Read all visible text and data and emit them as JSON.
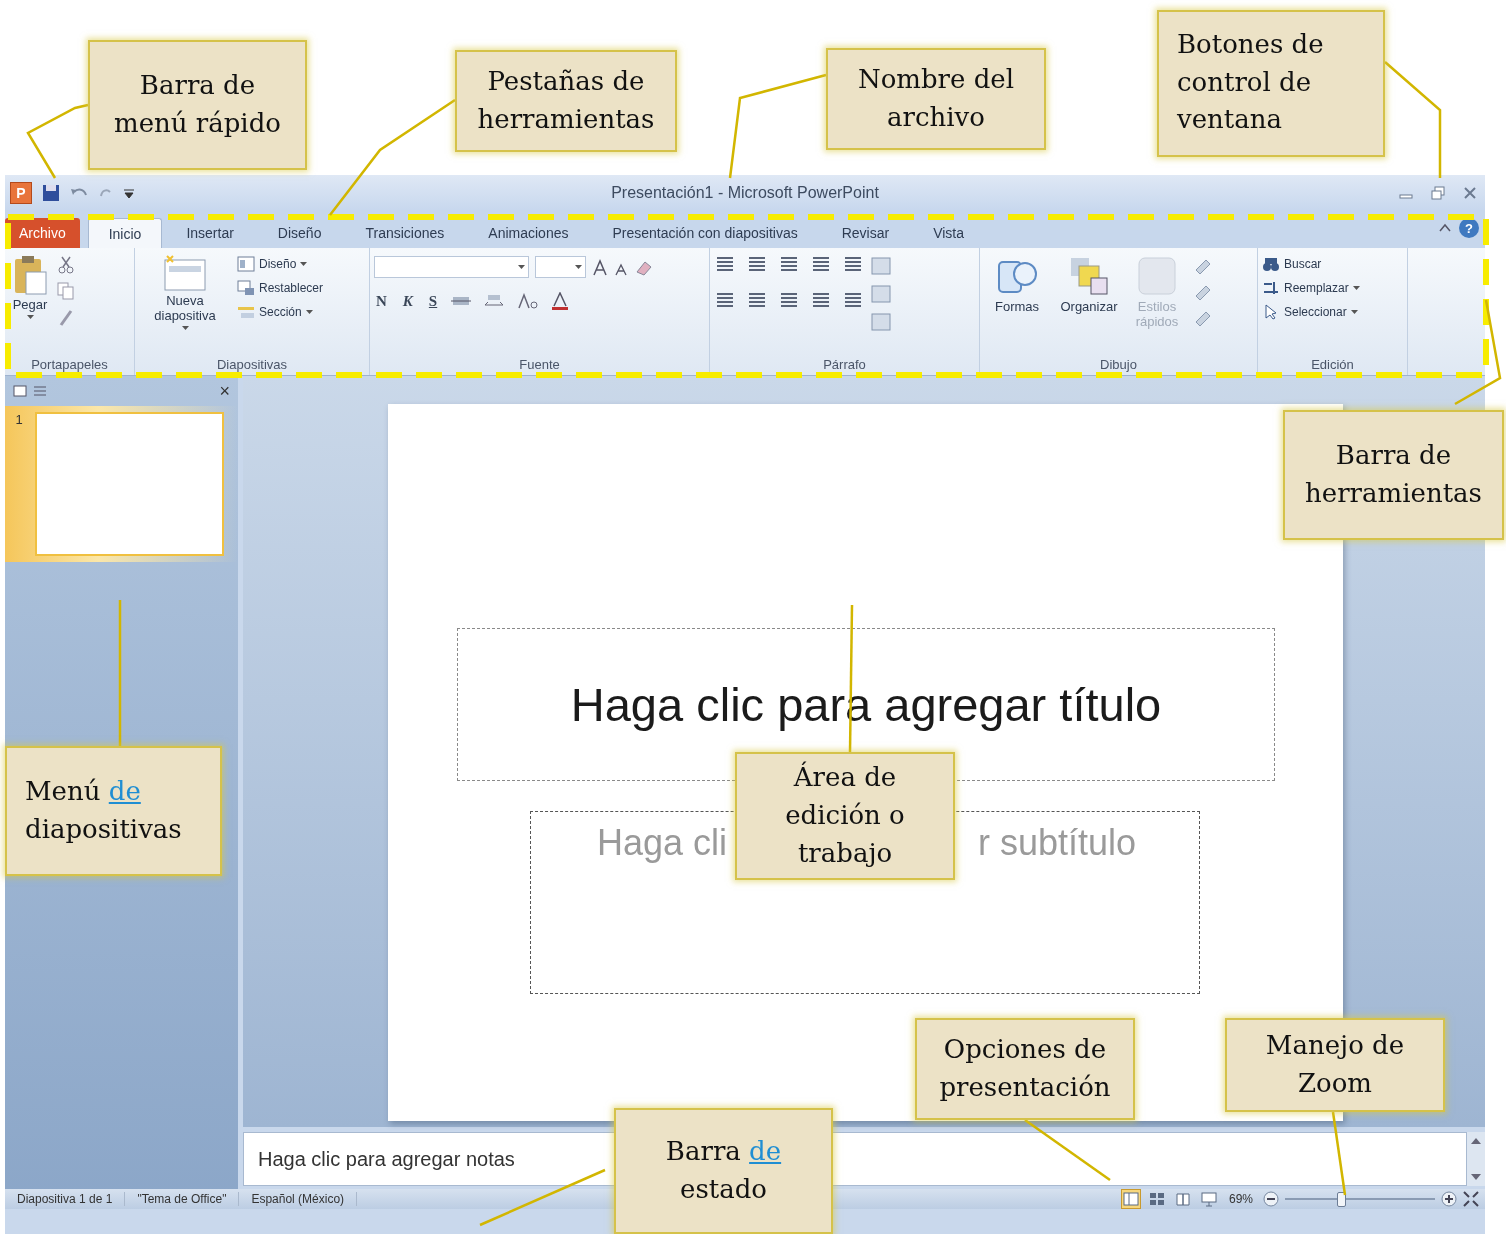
{
  "window": {
    "app_logo": "P",
    "title": "Presentación1 - Microsoft PowerPoint"
  },
  "tabs": [
    {
      "label": "Archivo",
      "kind": "file",
      "selected": false
    },
    {
      "label": "Inicio",
      "kind": "tab",
      "selected": true
    },
    {
      "label": "Insertar",
      "kind": "tab",
      "selected": false
    },
    {
      "label": "Diseño",
      "kind": "tab",
      "selected": false
    },
    {
      "label": "Transiciones",
      "kind": "tab",
      "selected": false
    },
    {
      "label": "Animaciones",
      "kind": "tab",
      "selected": false
    },
    {
      "label": "Presentación con diapositivas",
      "kind": "tab",
      "selected": false
    },
    {
      "label": "Revisar",
      "kind": "tab",
      "selected": false
    },
    {
      "label": "Vista",
      "kind": "tab",
      "selected": false
    }
  ],
  "help": "?",
  "ribbon": {
    "groups": [
      {
        "kind": "clipboard",
        "label": "Portapapeles",
        "paste": "Pegar"
      },
      {
        "kind": "slides",
        "label": "Diapositivas",
        "new_slide": "Nueva diapositiva",
        "items": [
          {
            "label": "Diseño",
            "dropdown": true
          },
          {
            "label": "Restablecer",
            "dropdown": false
          },
          {
            "label": "Sección",
            "dropdown": true
          }
        ]
      },
      {
        "kind": "font",
        "label": "Fuente",
        "format_letters": [
          "N",
          "K",
          "S"
        ]
      },
      {
        "kind": "paragraph",
        "label": "Párrafo"
      },
      {
        "kind": "drawing",
        "label": "Dibujo",
        "buttons": [
          {
            "label": "Formas",
            "disabled": false
          },
          {
            "label": "Organizar",
            "disabled": false
          },
          {
            "label": "Estilos rápidos",
            "disabled": true
          }
        ]
      },
      {
        "kind": "editing",
        "label": "Edición",
        "items": [
          {
            "label": "Buscar",
            "dropdown": false
          },
          {
            "label": "Reemplazar",
            "dropdown": true
          },
          {
            "label": "Seleccionar",
            "dropdown": true
          }
        ]
      }
    ]
  },
  "slide_panel": {
    "close": "×",
    "slides": [
      {
        "number": "1",
        "selected": true
      }
    ]
  },
  "slide": {
    "title_placeholder": "Haga clic para agregar título",
    "subtitle_visible": [
      "Haga cli",
      "r subtítulo"
    ]
  },
  "notes": {
    "prompt": "Haga clic para agregar notas"
  },
  "status_bar": {
    "items": [
      "Diapositiva 1 de 1",
      "\"Tema de Office\"",
      "Español (México)"
    ],
    "views": [
      {
        "kind": "normal",
        "selected": true
      },
      {
        "kind": "sorter",
        "selected": false
      },
      {
        "kind": "reading",
        "selected": false
      },
      {
        "kind": "slideshow",
        "selected": false
      }
    ],
    "zoom": "69%",
    "zoom_slider": {
      "level": 0.37
    }
  },
  "callouts": [
    {
      "text": "Barra de menú rápido"
    },
    {
      "text": "Pestañas de herramientas"
    },
    {
      "text": "Nombre del archivo"
    },
    {
      "text": "Botones de control de ventana"
    },
    {
      "text": "Barra de herramientas"
    },
    {
      "text": "Menú",
      "link": "de",
      "text_after": "diapositivas"
    },
    {
      "text": "Área de edición o trabajo"
    },
    {
      "text": "Opciones de presentación"
    },
    {
      "text": "Manejo de Zoom"
    },
    {
      "text": "Barra",
      "link": "de",
      "text_after": "estado"
    }
  ]
}
